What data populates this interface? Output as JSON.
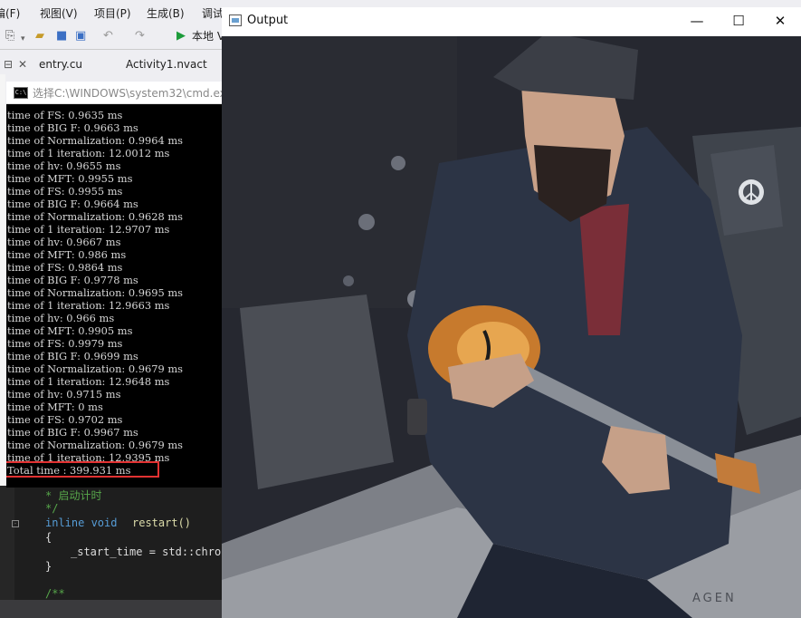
{
  "vs": {
    "menu": [
      "编(F)",
      "视图(V)",
      "项目(P)",
      "生成(B)",
      "调试"
    ],
    "toolbar": {
      "run_label": "本地 V"
    },
    "tabs": [
      "entry.cu",
      "Activity1.nvact"
    ],
    "code": {
      "comment_line": "* 启动计时",
      "comment_end": "*/",
      "signature_kw": "inline void",
      "signature_fn": "restart()",
      "brace_open": "{",
      "body": "_start_time = std::chror",
      "brace_close": "}",
      "doc_start": "/**"
    }
  },
  "cmd": {
    "title": "选择C:\\WINDOWS\\system32\\cmd.ex",
    "icon_text": "C:\\",
    "lines": [
      "time of FS: 0.9635 ms",
      "time of BIG F: 0.9663 ms",
      "time of Normalization: 0.9964 ms",
      "time of 1 iteration: 12.0012 ms",
      "time of hv: 0.9655 ms",
      "time of MFT: 0.9955 ms",
      "time of FS: 0.9955 ms",
      "time of BIG F: 0.9664 ms",
      "time of Normalization: 0.9628 ms",
      "time of 1 iteration: 12.9707 ms",
      "time of hv: 0.9667 ms",
      "time of MFT: 0.986 ms",
      "time of FS: 0.9864 ms",
      "time of BIG F: 0.9778 ms",
      "time of Normalization: 0.9695 ms",
      "time of 1 iteration: 12.9663 ms",
      "time of hv: 0.966 ms",
      "time of MFT: 0.9905 ms",
      "time of FS: 0.9979 ms",
      "time of BIG F: 0.9699 ms",
      "time of Normalization: 0.9679 ms",
      "time of 1 iteration: 12.9648 ms",
      "time of hv: 0.9715 ms",
      "time of MFT: 0 ms",
      "time of FS: 0.9702 ms",
      "time of BIG F: 0.9967 ms",
      "time of Normalization: 0.9679 ms",
      "time of 1 iteration: 12.9395 ms"
    ],
    "total": "Total time : 399.931 ms",
    "highlight_color": "#e23232"
  },
  "output_window": {
    "title": "Output",
    "minimize_glyph": "—",
    "maximize_glyph": "☐",
    "close_glyph": "✕",
    "image_icons": [
      "peace-sign-icon"
    ],
    "image_sign_text": "AGEN"
  }
}
